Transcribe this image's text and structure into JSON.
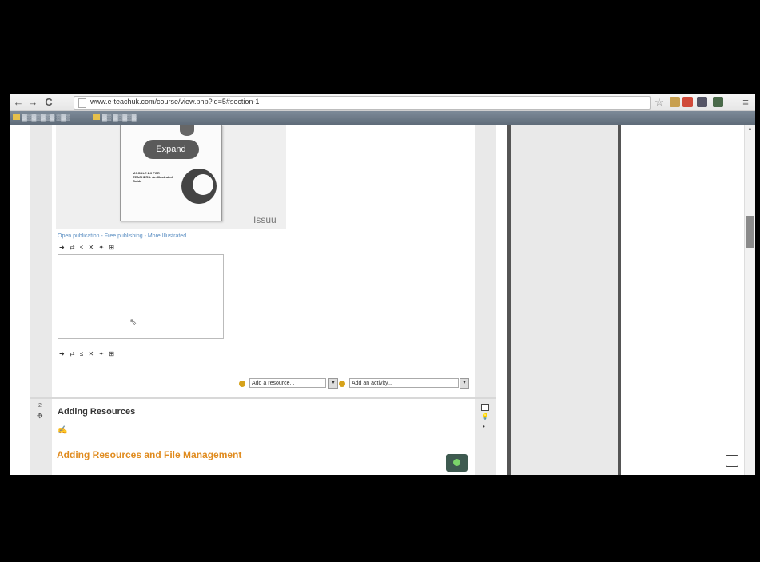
{
  "browser": {
    "back_glyph": "←",
    "forward_glyph": "→",
    "reload_glyph": "C",
    "url": "www.e-teachuk.com/course/view.php?id=5#section-1",
    "star_glyph": "☆",
    "menu_glyph": "≡",
    "bookmarks": [
      "▓▒▓▒▓▒▓ ▒▓▒",
      "▓▒ ▓▒▓▒▓"
    ]
  },
  "issuu": {
    "expand_label": "Expand",
    "logo": "Issuu",
    "book_text": "MOODLE 2.0 FOR TEACHERS: An Illustrated Guide",
    "links": "Open publication - Free publishing - More Illustrated"
  },
  "editor": {
    "toolbar_top": "➜ ⇄ ≤ ✕ ✦ ⊞",
    "toolbar_bottom": "➜ ⇄ ≤ ✕ ✦ ⊞",
    "cursor_glyph": "⇖"
  },
  "add_controls": {
    "resource_placeholder": "Add a resource...",
    "activity_placeholder": "Add an activity..."
  },
  "section2": {
    "number": "2",
    "move_glyph": "✥",
    "title": "Adding Resources",
    "edit_glyph": "✍",
    "heading": "Adding Resources and File Management",
    "cut_text": "▁▂▁ ▂▁▂▁ ▂▁ ▁▂▁▂"
  },
  "right_controls": {
    "bulb_glyph": "💡",
    "dot_glyph": "•"
  },
  "scrollbar": {
    "up_glyph": "▲"
  },
  "colors": {
    "heading_orange": "#e08b1e",
    "link_blue": "#5a8ec2",
    "divider_dark": "#555555"
  }
}
